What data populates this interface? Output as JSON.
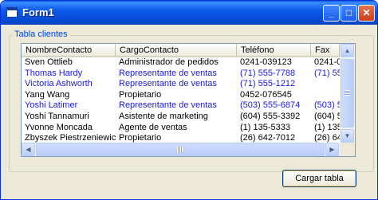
{
  "window": {
    "title": "Form1"
  },
  "group": {
    "label": "Tabla clientes"
  },
  "table": {
    "columns": [
      "NombreContacto",
      "CargoContacto",
      "Teléfono",
      "Fax"
    ],
    "rows": [
      {
        "cells": [
          "Sven Ottlieb",
          "Administrador de pedidos",
          "0241-039123",
          "0241-0"
        ],
        "color": "#000000"
      },
      {
        "cells": [
          "Thomas Hardy",
          "Representante de ventas",
          "(71) 555-7788",
          "(71) 55"
        ],
        "color": "#1c1cd6"
      },
      {
        "cells": [
          "Victoria Ashworth",
          "Representante de ventas",
          "(71) 555-1212",
          ""
        ],
        "color": "#1c1cd6"
      },
      {
        "cells": [
          "Yang Wang",
          "Propietario",
          "0452-076545",
          ""
        ],
        "color": "#000000"
      },
      {
        "cells": [
          "Yoshi Latimer",
          "Representante de ventas",
          "(503) 555-6874",
          "(503) 5"
        ],
        "color": "#1c1cd6"
      },
      {
        "cells": [
          "Yoshi Tannamuri",
          "Asistente de marketing",
          "(604) 555-3392",
          "(604) 5"
        ],
        "color": "#000000"
      },
      {
        "cells": [
          "Yvonne Moncada",
          "Agente de ventas",
          "(1) 135-5333",
          "(1) 135"
        ],
        "color": "#000000"
      },
      {
        "cells": [
          "Zbyszek Piestrzeniewicz",
          "Propietario",
          "(26) 642-7012",
          "(26) 64"
        ],
        "color": "#000000"
      }
    ]
  },
  "buttons": {
    "load_label": "Cargar tabla"
  },
  "icons": {
    "minimize": "minimize-icon",
    "maximize": "maximize-icon",
    "close": "close-icon"
  }
}
